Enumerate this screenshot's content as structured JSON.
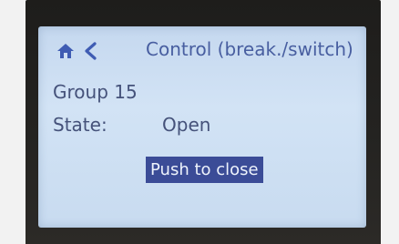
{
  "screen": {
    "header": {
      "home_icon": "home-icon",
      "back_icon": "chevron-left-icon",
      "title": "Control (break./switch)"
    },
    "group": "Group 15",
    "state": {
      "label": "State:",
      "value": "Open"
    },
    "action_button": {
      "label": "Push to close"
    }
  },
  "colors": {
    "screen_background": "#cfe0f3",
    "text": "#45527a",
    "title": "#485ea0",
    "highlight": "#3b4c97",
    "highlight_text": "#eef3fc",
    "bezel": "#242321"
  }
}
